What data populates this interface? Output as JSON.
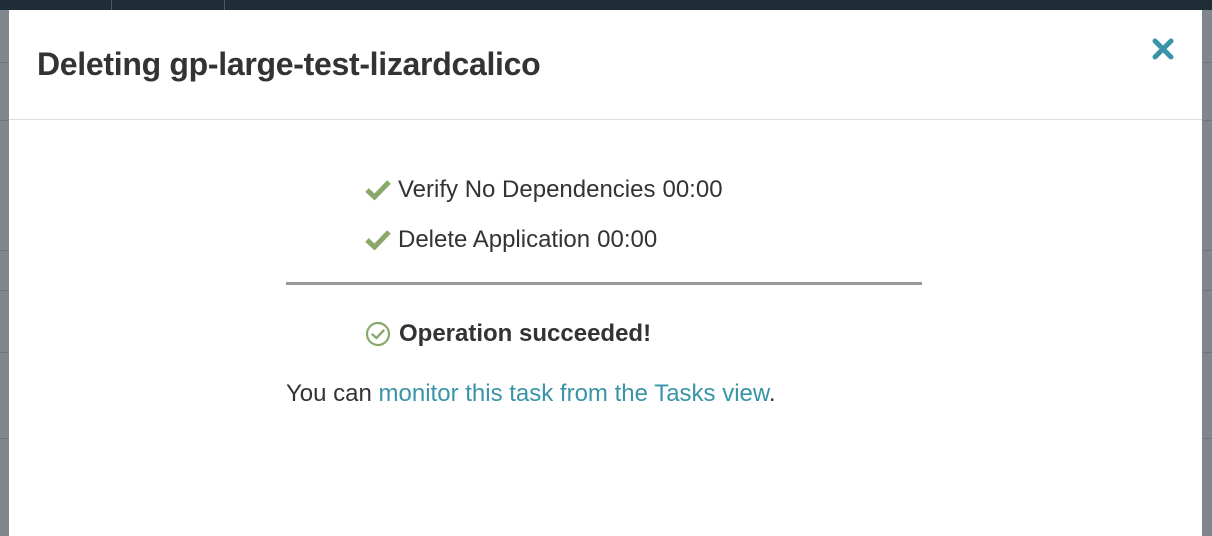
{
  "modal": {
    "title": "Deleting gp-large-test-lizardcalico",
    "close_icon": "close-x-icon"
  },
  "steps": [
    {
      "label": "Verify No Dependencies",
      "time": "00:00",
      "status": "complete",
      "icon": "checkmark-icon"
    },
    {
      "label": "Delete Application",
      "time": "00:00",
      "status": "complete",
      "icon": "checkmark-icon"
    }
  ],
  "result": {
    "text": "Operation succeeded!",
    "icon": "circle-check-icon"
  },
  "monitor": {
    "prefix": "You can ",
    "link_text": "monitor this task from the Tasks view",
    "suffix": "."
  },
  "colors": {
    "success_green": "#8aa86a",
    "link_teal": "#3a94a8",
    "close_teal": "#3a94a8",
    "text_dark": "#333333"
  }
}
